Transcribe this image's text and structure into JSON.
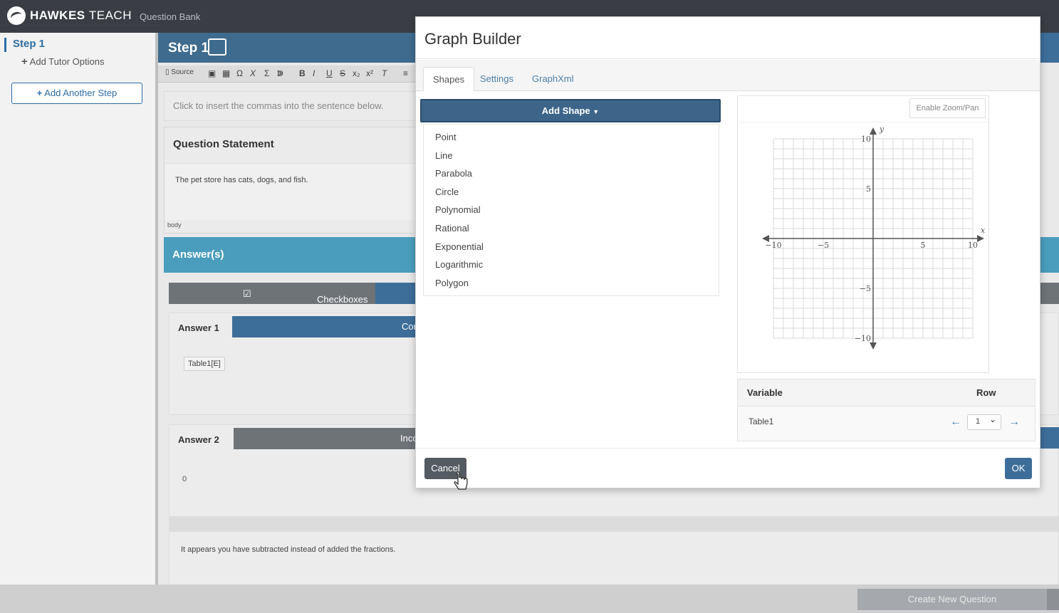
{
  "app": {
    "brand_bold": "HAWKES",
    "brand_light": "TEACH",
    "breadcrumb": "Question Bank"
  },
  "sidebar": {
    "step_label": "Step 1",
    "add_tutor_label": "Add Tutor Options",
    "add_step_label": "Add Another Step"
  },
  "editor": {
    "step_title": "Step 1",
    "toolbar": {
      "source_label": "Source"
    },
    "instruction_placeholder": "Click to insert the commas into the sentence below.",
    "question_statement_title": "Question Statement",
    "question_text": "The pet store has cats, dogs, and fish.",
    "editor_path": "body",
    "answers_title": "Answer(s)",
    "answer_type": "Checkboxes",
    "answer1_label": "Answer 1",
    "answer1_state": "Cor",
    "answer1_chip": "Table1[E]",
    "answer2_label": "Answer 2",
    "answer2_state": "Inco",
    "answer2_value": "0",
    "answer2_feedback": "It appears you have subtracted instead of added the fractions."
  },
  "footer": {
    "create_label": "Create New Question"
  },
  "modal": {
    "title": "Graph Builder",
    "tabs": [
      "Shapes",
      "Settings",
      "GraphXml"
    ],
    "active_tab": "Shapes",
    "add_shape_label": "Add Shape",
    "shapes": [
      "Point",
      "Line",
      "Parabola",
      "Circle",
      "Polynomial",
      "Rational",
      "Exponential",
      "Logarithmic",
      "Polygon"
    ],
    "zoom_label": "Enable Zoom/Pan",
    "graph": {
      "x_label": "x",
      "y_label": "y",
      "x_ticks": [
        "−10",
        "−5",
        "5",
        "10"
      ],
      "y_ticks": [
        "10",
        "5",
        "−5",
        "−10"
      ],
      "x_range": [
        -10,
        10
      ],
      "y_range": [
        -10,
        10
      ],
      "grid": true
    },
    "variable_table": {
      "col_variable": "Variable",
      "col_row": "Row",
      "rows": [
        {
          "name": "Table1",
          "row": "1"
        }
      ]
    },
    "cancel_label": "Cancel",
    "ok_label": "OK"
  },
  "colors": {
    "primary": "#3d6e99",
    "header_blue": "#3f6b8e",
    "answers_teal": "#4a9dbd",
    "topbar": "#3a3e44"
  }
}
